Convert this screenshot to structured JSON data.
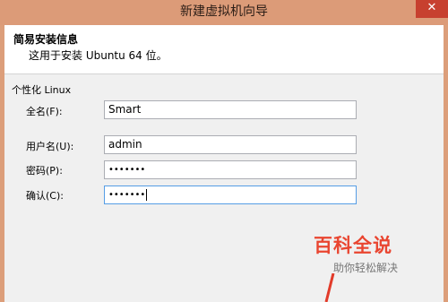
{
  "window": {
    "title": "新建虚拟机向导"
  },
  "header": {
    "title": "简易安装信息",
    "subtitle": "这用于安装 Ubuntu 64 位。"
  },
  "group": {
    "label": "个性化 Linux"
  },
  "fields": {
    "fullname": {
      "label": "全名(F):",
      "value": "Smart"
    },
    "username": {
      "label": "用户名(U):",
      "value": "admin"
    },
    "password": {
      "label": "密码(P):",
      "value": "•••••••"
    },
    "confirm": {
      "label": "确认(C):",
      "value": "•••••••"
    }
  },
  "watermark": {
    "brand": "百科全说",
    "slogan": "助你轻松解决"
  },
  "colors": {
    "titlebar": "#dc9b78",
    "close": "#c7402f",
    "watermark_brand": "#e94530",
    "focus_border": "#569de5"
  }
}
